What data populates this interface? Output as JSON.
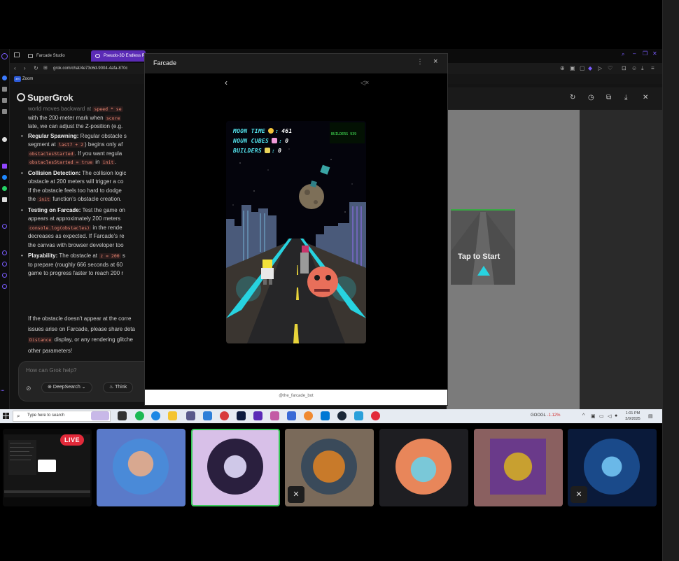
{
  "browser": {
    "tabs": [
      {
        "label": "Farcade Studio"
      },
      {
        "label": "Pseudo-3D Endless R"
      }
    ],
    "url": "grok.com/chat/4e73c6d-9004-4afa-870c",
    "bookmark_zoom": "Zoom"
  },
  "grok": {
    "logo": "SuperGrok",
    "lines": [
      {
        "text": "world moves backward at `speed * se",
        "type": "plain"
      },
      {
        "text": "with the 200-meter mark when",
        "code": "score",
        "type": "plain"
      },
      {
        "text": "late, we can adjust the Z-position (e.g.",
        "type": "plain"
      }
    ],
    "bullets": [
      {
        "title": "Regular Spawning:",
        "text": " Regular obstacle s",
        "l2": "segment at",
        "l2code": "last7 + 2",
        "l2tail": ") begins only af",
        "l3code": "obstaclesStarted",
        "l3tail": ". If you want regula",
        "l4code": "obstaclesStarted = true",
        "l4mid": " in ",
        "l4code2": "init",
        "l4tail": "."
      },
      {
        "title": "Collision Detection:",
        "text": " The collision logic",
        "l2": "obstacle at 200 meters will trigger a co",
        "l3": "If the obstacle feels too hard to dodge",
        "l4pre": "the ",
        "l4code": "init",
        "l4tail": " function's obstacle creation."
      },
      {
        "title": "Testing on Farcade:",
        "text": " Test the game on",
        "l2": "appears at approximately 200 meters",
        "l3code": "console.log(obstacles)",
        "l3tail": " in the rende",
        "l4": "decreases as expected. If Farcade's re",
        "l5": "the canvas with browser developer too"
      },
      {
        "title": "Playability:",
        "text": " The obstacle at ",
        "code": "z = 200",
        "tail": " s",
        "l2": "to prepare (roughly 666 seconds at 60",
        "l3": "game to progress faster to reach 200 r"
      }
    ],
    "footer": [
      "If the obstacle doesn't appear at the corre",
      "issues arise on Farcade, please share deta",
      "display, or any rendering glitche",
      "other parameters!"
    ],
    "footer_code": "Distance",
    "input_placeholder": "How can Grok help?",
    "deepsearch_label": "DeepSearch",
    "think_label": "Think"
  },
  "right_pane": {
    "tap_to_start": "Tap to Start"
  },
  "modal": {
    "title": "Farcade",
    "handle": "@the_farcade_bot",
    "game": {
      "moon_time_label": "MOON TIME",
      "moon_time_value": "461",
      "noun_cubes_label": "NOUN CUBES",
      "noun_cubes_value": "0",
      "builders_label": "BUILDERS",
      "builders_value": "0",
      "badge": "BUILDERS 939"
    }
  },
  "taskbar": {
    "search_placeholder": "Type here to search",
    "stock_name": "GOOGL",
    "stock_change": "-1.12%",
    "time": "1:01 PM",
    "date": "3/9/2025"
  },
  "stream": {
    "live_label": "LIVE"
  },
  "colors": {
    "accent": "#5b2bb6",
    "neon": "#27d3e0",
    "live": "#e22a3a"
  }
}
